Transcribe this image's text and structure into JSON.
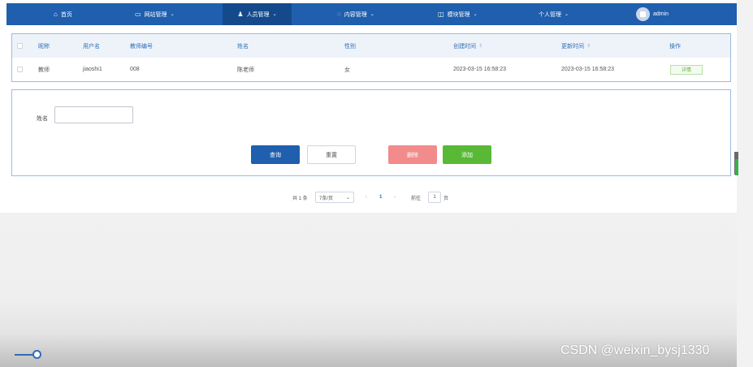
{
  "nav": {
    "items": [
      {
        "icon": "home-icon",
        "glyph": "⌂",
        "label": "首页",
        "dropdown": false
      },
      {
        "icon": "monitor-icon",
        "glyph": "▭",
        "label": "网站管理",
        "dropdown": true
      },
      {
        "icon": "user-icon",
        "glyph": "♟",
        "label": "人员管理",
        "dropdown": true,
        "active": true
      },
      {
        "icon": "chat-icon",
        "glyph": "◌",
        "label": "内容管理",
        "dropdown": true
      },
      {
        "icon": "module-icon",
        "glyph": "◫",
        "label": "模块管理",
        "dropdown": true
      },
      {
        "icon": "",
        "glyph": "",
        "label": "个人管理",
        "dropdown": true
      }
    ],
    "chevron": "⌄",
    "user": "admin"
  },
  "table": {
    "headers": [
      "昵称",
      "用户名",
      "教师编号",
      "姓名",
      "性别",
      "创建时间",
      "更新时间",
      "操作"
    ],
    "sort_glyph": "⇕",
    "rows": [
      {
        "nickname": "教师",
        "username": "jiaoshi1",
        "teacher_no": "008",
        "name": "陈老师",
        "gender": "女",
        "created": "2023-03-15 16:58:23",
        "updated": "2023-03-15 16:58:23",
        "action": "详情"
      }
    ]
  },
  "form": {
    "name_label": "姓名",
    "name_value": "",
    "name_placeholder": "",
    "buttons": {
      "search": "查询",
      "reset": "重置",
      "delete": "删除",
      "add": "添加"
    }
  },
  "pagination": {
    "total": "共 1 条",
    "page_size": "7条/页",
    "prev": "‹",
    "current": "1",
    "next": "›",
    "goto_label": "前往",
    "goto_value": "1",
    "page_unit": "页"
  },
  "watermark": "CSDN @weixin_bysj1330",
  "colors": {
    "nav_bg": "#1f5fae",
    "active_nav": "#144a8c",
    "header_text": "#2f6db5",
    "delete": "#f28b8b",
    "add": "#59b936"
  }
}
